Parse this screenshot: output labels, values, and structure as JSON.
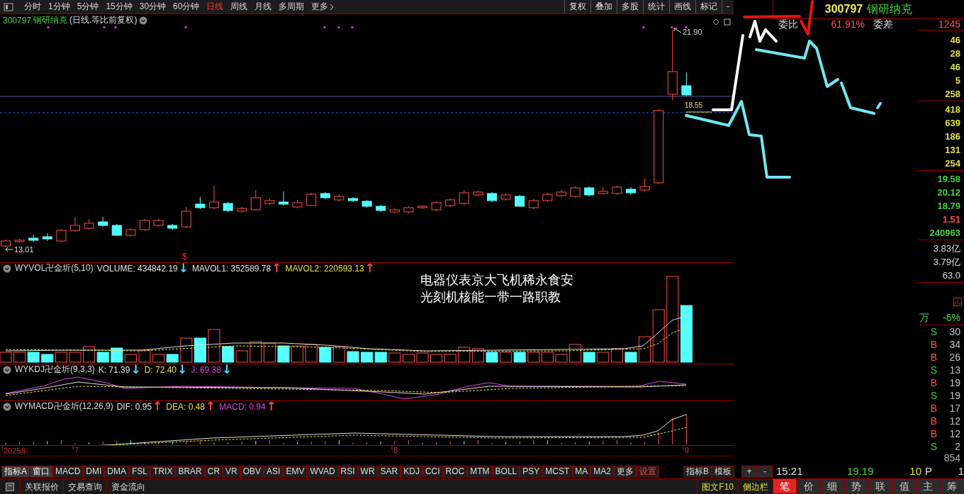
{
  "toolbar": {
    "periods": [
      {
        "label": "分时",
        "selected": false
      },
      {
        "label": "1分钟",
        "selected": false
      },
      {
        "label": "5分钟",
        "selected": false
      },
      {
        "label": "15分钟",
        "selected": false
      },
      {
        "label": "30分钟",
        "selected": false
      },
      {
        "label": "60分钟",
        "selected": false
      },
      {
        "label": "日线",
        "selected": true
      },
      {
        "label": "周线",
        "selected": false
      },
      {
        "label": "月线",
        "selected": false
      },
      {
        "label": "多周期",
        "selected": false
      },
      {
        "label": "更多",
        "selected": false
      }
    ],
    "tools": [
      "复权",
      "叠加",
      "多股",
      "统计",
      "画线",
      "标记",
      "-"
    ]
  },
  "stock_header": {
    "code": "300797",
    "name": "钢研纳克",
    "mode": "(日线.等比前复权)"
  },
  "price_chart": {
    "high": "21.90",
    "low": "13.01",
    "marked_price": "18.55",
    "signal": "$"
  },
  "overlay_text": [
    "电器仪表京大飞机稀永食安",
    "光刻机核能一带一路职教"
  ],
  "indicators": [
    {
      "name": "WYVOL卍金圻(5,10)",
      "values": [
        {
          "text": "VOLUME: 434842.19",
          "arrow": {
            "text": "↓",
            "color": "#40e0ff"
          },
          "color": "#e0e0e0"
        },
        {
          "text": "MAVOL1: 352589.78",
          "arrow": {
            "text": "↑",
            "color": "#ff4040"
          },
          "color": "#e0e0e0"
        },
        {
          "text": "MAVOL2: 220593.13",
          "arrow": {
            "text": "↑",
            "color": "#ff4040"
          },
          "color": "#e8e040"
        }
      ]
    },
    {
      "name": "WYKDJ卍金圻(9,3,3)",
      "values": [
        {
          "text": "K: 71.39",
          "arrow": {
            "text": "↓",
            "color": "#40e0ff"
          },
          "color": "#e0e0e0"
        },
        {
          "text": "D: 72.40",
          "arrow": {
            "text": "↓",
            "color": "#40e0ff"
          },
          "color": "#e8e040"
        },
        {
          "text": "J: 69.38",
          "arrow": {
            "text": "↓",
            "color": "#40e0ff"
          },
          "color": "#e040e0"
        }
      ]
    },
    {
      "name": "WYMACD卍金圻(12,26,9)",
      "values": [
        {
          "text": "DIF: 0.95",
          "arrow": {
            "text": "↑",
            "color": "#ff4040"
          },
          "color": "#e0e0e0"
        },
        {
          "text": "DEA: 0.48",
          "arrow": {
            "text": "↑",
            "color": "#ff4040"
          },
          "color": "#e8e040"
        },
        {
          "text": "MACD: 0.94",
          "arrow": {
            "text": "↑",
            "color": "#ff4040"
          },
          "color": "#e040e0"
        }
      ]
    }
  ],
  "date_axis": [
    "2025年",
    "7",
    "8",
    "9"
  ],
  "quote_panel": {
    "code": "300797",
    "name": "钢研纳克",
    "ratio_label": "委比",
    "ratio": "61.91%",
    "diff_label": "委差",
    "diff": "1245",
    "asks": [
      "46",
      "28",
      "46",
      "5",
      "258"
    ],
    "bids": [
      "418",
      "639",
      "186",
      "131",
      "254"
    ],
    "stats": [
      {
        "value": "19.58",
        "color": "#40d040"
      },
      {
        "value": "20.12",
        "color": "#40d040"
      },
      {
        "value": "18.79",
        "color": "#40d040"
      },
      {
        "value": "1.51",
        "color": "#ff5050"
      },
      {
        "value": "240963",
        "color": "#40d040"
      }
    ],
    "amounts": [
      "3.83亿",
      "3.79亿",
      "63.0"
    ],
    "flow_unit": "万",
    "flow_change": "-6%",
    "ticks": [
      {
        "side": "S",
        "kind": "sell",
        "volume": "30"
      },
      {
        "side": "B",
        "kind": "buy",
        "volume": "34"
      },
      {
        "side": "B",
        "kind": "buy",
        "volume": "26"
      },
      {
        "side": "S",
        "kind": "sell",
        "volume": "13"
      },
      {
        "side": "B",
        "kind": "buy",
        "volume": "19"
      },
      {
        "side": "S",
        "kind": "sell",
        "volume": "19"
      },
      {
        "side": "B",
        "kind": "buy",
        "volume": "17"
      },
      {
        "side": "B",
        "kind": "buy",
        "volume": "12"
      },
      {
        "side": "B",
        "kind": "buy",
        "volume": "12"
      },
      {
        "side": "S",
        "kind": "sell",
        "volume": "2"
      }
    ],
    "partial_volume": "854",
    "last_tick": {
      "time": "15:21",
      "price": "19.19",
      "volume": "10",
      "flag": "P",
      "count": "1"
    }
  },
  "indicator_bar": {
    "items": [
      {
        "label": "指标A",
        "kind": "menu"
      },
      {
        "label": "窗口",
        "kind": "menu"
      },
      {
        "label": "MACD",
        "kind": "indicator"
      },
      {
        "label": "DMI",
        "kind": "indicator"
      },
      {
        "label": "DMA",
        "kind": "indicator"
      },
      {
        "label": "FSL",
        "kind": "indicator"
      },
      {
        "label": "TRIX",
        "kind": "indicator"
      },
      {
        "label": "BRAR",
        "kind": "indicator"
      },
      {
        "label": "CR",
        "kind": "indicator"
      },
      {
        "label": "VR",
        "kind": "indicator"
      },
      {
        "label": "OBV",
        "kind": "indicator"
      },
      {
        "label": "ASI",
        "kind": "indicator"
      },
      {
        "label": "EMV",
        "kind": "indicator"
      },
      {
        "label": "WVAD",
        "kind": "indicator"
      },
      {
        "label": "RSI",
        "kind": "indicator"
      },
      {
        "label": "WR",
        "kind": "indicator"
      },
      {
        "label": "SAR",
        "kind": "indicator"
      },
      {
        "label": "KDJ",
        "kind": "indicator"
      },
      {
        "label": "CCI",
        "kind": "indicator"
      },
      {
        "label": "ROC",
        "kind": "indicator"
      },
      {
        "label": "MTM",
        "kind": "indicator"
      },
      {
        "label": "BOLL",
        "kind": "indicator"
      },
      {
        "label": "PSY",
        "kind": "indicator"
      },
      {
        "label": "MCST",
        "kind": "indicator"
      },
      {
        "label": "MA",
        "kind": "indicator"
      },
      {
        "label": "MA2",
        "kind": "indicator"
      },
      {
        "label": "更多",
        "kind": "indicator"
      },
      {
        "label": "设置",
        "kind": "action"
      }
    ],
    "right": [
      "指标B",
      "模板"
    ],
    "zoom": [
      "+",
      "-"
    ]
  },
  "status_bar": {
    "links": [
      "关联报价",
      "交易查询",
      "资金流向"
    ],
    "right": [
      "图文F10",
      "侧边栏"
    ]
  },
  "quote_tabs": [
    {
      "label": "笔",
      "selected": true
    },
    {
      "label": "价",
      "selected": false
    },
    {
      "label": "细",
      "selected": false
    },
    {
      "label": "势",
      "selected": false
    },
    {
      "label": "联",
      "selected": false
    },
    {
      "label": "值",
      "selected": false
    },
    {
      "label": "主",
      "selected": false
    },
    {
      "label": "筹",
      "selected": false
    }
  ]
}
